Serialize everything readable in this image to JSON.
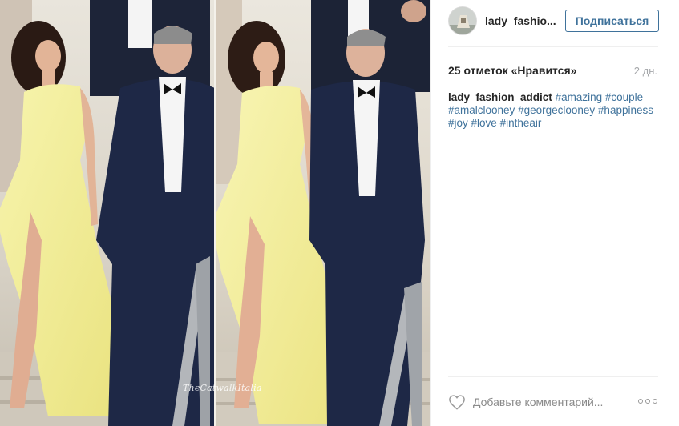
{
  "post": {
    "photo": {
      "description_icon": "photo-of-couple",
      "watermark": "TheCatwalkItalia"
    },
    "header": {
      "username": "lady_fashio...",
      "follow_label": "Подписаться",
      "avatar_icon": "avatar-icon"
    },
    "stats": {
      "likes": "25 отметок «Нравится»",
      "time": "2 дн."
    },
    "caption": {
      "author": "lady_fashion_addict",
      "hashtags": [
        "#amazing",
        "#couple",
        "#amalclooney",
        "#georgeclooney",
        "#happiness",
        "#joy",
        "#love",
        "#intheair"
      ]
    },
    "comment": {
      "placeholder": "Добавьте комментарий...",
      "like_icon": "heart-icon",
      "more_icon": "more-options-icon"
    }
  },
  "colors": {
    "link": "#3f729b",
    "muted": "#a5a7aa",
    "border": "#efefef",
    "dress": "#f3ef9a",
    "suit": "#1e2846"
  }
}
